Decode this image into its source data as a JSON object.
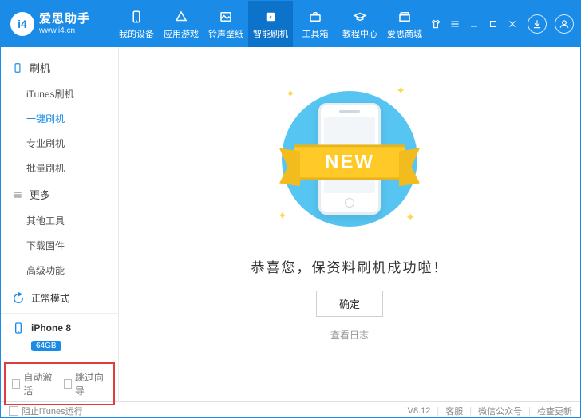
{
  "brand": {
    "cn": "爱思助手",
    "en": "www.i4.cn",
    "logo_glyph": "i4"
  },
  "nav": [
    {
      "label": "我的设备"
    },
    {
      "label": "应用游戏"
    },
    {
      "label": "铃声壁纸"
    },
    {
      "label": "智能刷机",
      "active": true
    },
    {
      "label": "工具箱"
    },
    {
      "label": "教程中心"
    },
    {
      "label": "爱思商城"
    }
  ],
  "sidebar": {
    "section_flash": "刷机",
    "flash_items": [
      {
        "label": "iTunes刷机"
      },
      {
        "label": "一键刷机",
        "active": true
      },
      {
        "label": "专业刷机"
      },
      {
        "label": "批量刷机"
      }
    ],
    "section_more": "更多",
    "more_items": [
      {
        "label": "其他工具"
      },
      {
        "label": "下载固件"
      },
      {
        "label": "高级功能"
      }
    ],
    "mode": "正常模式",
    "device": "iPhone 8",
    "device_badge": "64GB",
    "opts": {
      "auto_activate": "自动激活",
      "skip_guide": "跳过向导"
    }
  },
  "main": {
    "ribbon_text": "NEW",
    "success": "恭喜您，保资料刷机成功啦！",
    "confirm": "确定",
    "log": "查看日志"
  },
  "status": {
    "block_itunes": "阻止iTunes运行",
    "version": "V8.12",
    "support": "客服",
    "wechat": "微信公众号",
    "update": "检查更新"
  }
}
